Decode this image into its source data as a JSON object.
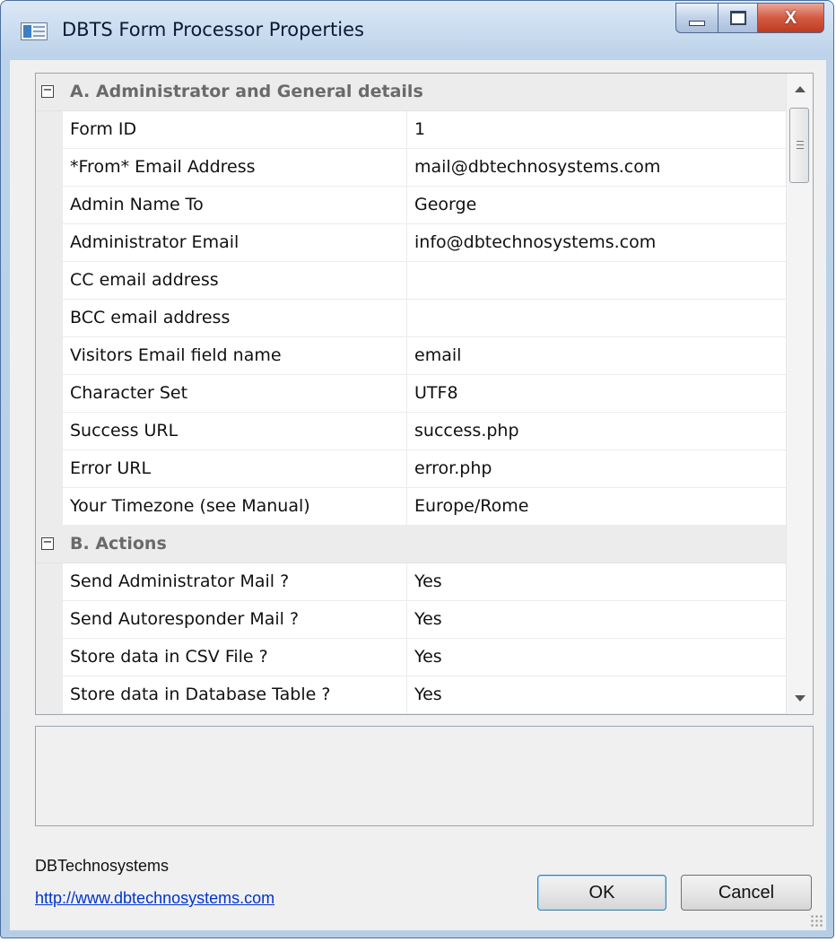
{
  "window": {
    "title": "DBTS Form Processor Properties",
    "close_glyph": "X"
  },
  "categories": [
    {
      "label": "A. Administrator and General details",
      "properties": [
        {
          "name": "Form ID",
          "value": "1"
        },
        {
          "name": "*From* Email Address",
          "value": "mail@dbtechnosystems.com"
        },
        {
          "name": "Admin Name To",
          "value": "George"
        },
        {
          "name": "Administrator Email",
          "value": "info@dbtechnosystems.com"
        },
        {
          "name": "CC email address",
          "value": ""
        },
        {
          "name": "BCC email address",
          "value": ""
        },
        {
          "name": "Visitors Email field name",
          "value": "email"
        },
        {
          "name": "Character Set",
          "value": "UTF8"
        },
        {
          "name": "Success URL",
          "value": "success.php"
        },
        {
          "name": "Error URL",
          "value": "error.php"
        },
        {
          "name": "Your Timezone (see Manual)",
          "value": "Europe/Rome"
        }
      ]
    },
    {
      "label": "B. Actions",
      "properties": [
        {
          "name": "Send Administrator Mail ?",
          "value": "Yes"
        },
        {
          "name": "Send Autoresponder Mail ?",
          "value": "Yes"
        },
        {
          "name": "Store data in CSV File ?",
          "value": "Yes"
        },
        {
          "name": "Store data in Database Table ?",
          "value": "Yes"
        }
      ]
    }
  ],
  "footer": {
    "company": "DBTechnosystems",
    "link": "http://www.dbtechnosystems.com",
    "ok_label": "OK",
    "cancel_label": "Cancel"
  },
  "icons": {
    "app": "form-app-icon",
    "collapse": "collapse-minus-icon",
    "scroll_up": "scroll-up-arrow-icon",
    "scroll_down": "scroll-down-arrow-icon",
    "minimize": "minimize-icon",
    "maximize": "maximize-icon",
    "close": "close-icon"
  },
  "colors": {
    "accent": "#3c7fb1",
    "close_button": "#d45a42",
    "link": "#0033cc"
  }
}
